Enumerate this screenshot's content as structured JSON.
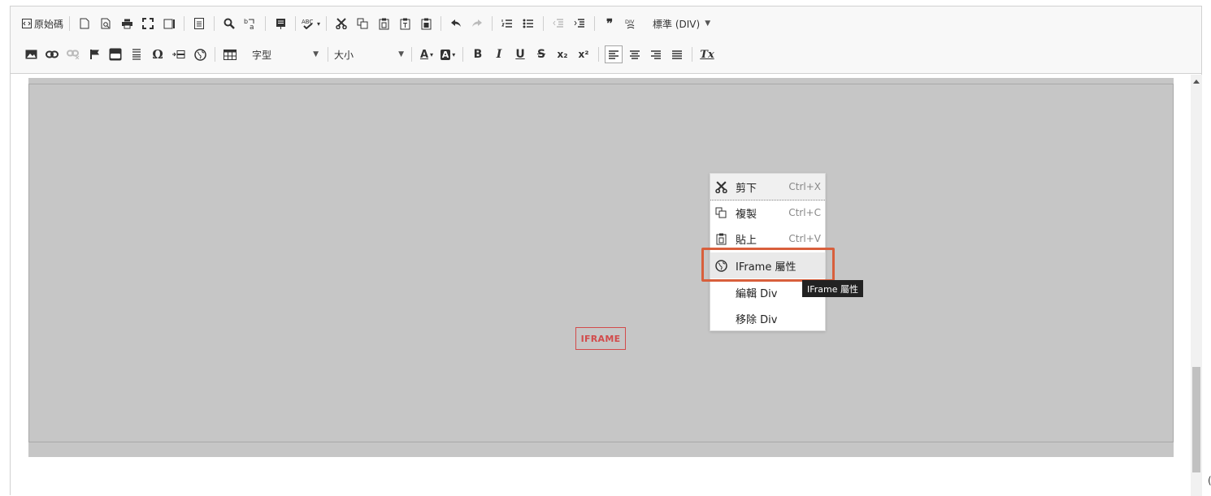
{
  "toolbar": {
    "source_label": "原始碼",
    "format_combo": "標準 (DIV)",
    "font_combo": "字型",
    "size_combo": "大小",
    "special_char": "Ω",
    "bold": "B",
    "italic": "I",
    "underline": "U",
    "strike": "S",
    "subscript": "x₂",
    "superscript": "x²",
    "remove_format": "Tx",
    "quote": "❞",
    "spell_check": "ABC",
    "text_color": "A",
    "bg_color": "A",
    "div": "DIV"
  },
  "content": {
    "iframe_placeholder": "IFRAME"
  },
  "context_menu": {
    "items": [
      {
        "label": "剪下",
        "shortcut": "Ctrl+X",
        "icon": "scissors-icon"
      },
      {
        "label": "複製",
        "shortcut": "Ctrl+C",
        "icon": "copy-icon"
      },
      {
        "label": "貼上",
        "shortcut": "Ctrl+V",
        "icon": "paste-icon"
      },
      {
        "label": "IFrame 屬性",
        "shortcut": "",
        "icon": "globe-icon"
      },
      {
        "label": "編輯 Div",
        "shortcut": ""
      },
      {
        "label": "移除 Div",
        "shortcut": ""
      }
    ]
  },
  "tooltip": "IFrame 屬性",
  "edge_char": "(",
  "colors": {
    "highlight": "#d85f3c",
    "iframe_red": "#d24b4b",
    "frame_gray": "#c6c6c6"
  }
}
